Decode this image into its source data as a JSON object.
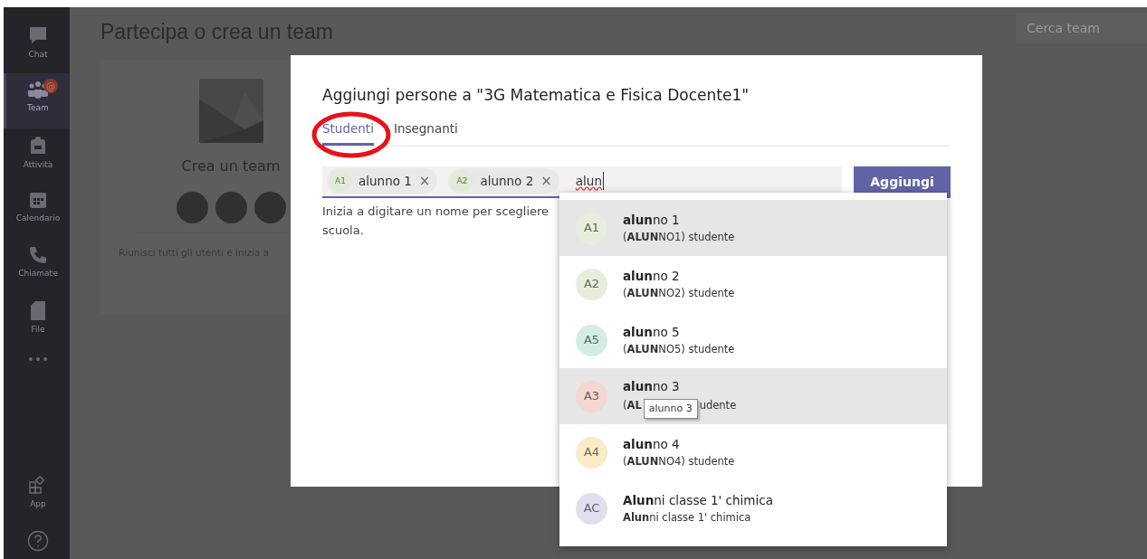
{
  "sidebar": {
    "items": [
      {
        "label": "Chat",
        "selected": false
      },
      {
        "label": "Team",
        "selected": true,
        "badge": "@"
      },
      {
        "label": "Attività",
        "selected": false
      },
      {
        "label": "Calendario",
        "selected": false
      },
      {
        "label": "Chiamate",
        "selected": false
      },
      {
        "label": "File",
        "selected": false
      },
      {
        "selected": false
      }
    ],
    "bottom_items": [
      {
        "label": "App",
        "selected": false
      },
      {
        "selected": false
      }
    ]
  },
  "page": {
    "title": "Partecipa o crea un team",
    "search": {
      "placeholder": "Cerca team"
    },
    "card": {
      "title": "Crea un team",
      "description": "Riunisci tutti gli utenti e inizia a"
    }
  },
  "dialog": {
    "title": "Aggiungi persone a \"3G Matematica e Fisica Docente1\"",
    "tabs": [
      {
        "label": "Studenti",
        "selected": true
      },
      {
        "label": "Insegnanti",
        "selected": false
      }
    ],
    "chips": [
      {
        "initials": "A1",
        "name": "alunno 1",
        "remove": "×"
      },
      {
        "initials": "A2",
        "name": "alunno 2",
        "remove": "×"
      }
    ],
    "typed": "alun",
    "add_button": "Aggiungi",
    "hint_lines": [
      "Inizia a digitare un nome per scegliere",
      "scuola."
    ],
    "suggestions": [
      {
        "initials": "A1",
        "color": "#e7efdc",
        "name": "**alun**no 1",
        "detail": "(**ALUN**NO1) studente",
        "highlighted": true
      },
      {
        "initials": "A2",
        "color": "#e7efdc",
        "name": "**alun**no 2",
        "detail": "(**ALUN**NO2) studente",
        "highlighted": false
      },
      {
        "initials": "A5",
        "color": "#d3ede3",
        "name": "**alun**no 5",
        "detail": "(**ALUN**NO5) studente",
        "highlighted": false
      },
      {
        "initials": "A3",
        "color": "#f4d6d3",
        "name": "**alun**no 3",
        "detail": "(**AL**",
        "detail_tail": "udente",
        "highlighted": true
      },
      {
        "initials": "A4",
        "color": "#f9ecc6",
        "name": "**alun**no 4",
        "detail": "(**ALUN**NO4) studente",
        "highlighted": false
      },
      {
        "initials": "AC",
        "color": "#e2def0",
        "name": "**Alun**ni classe 1' chimica",
        "detail": "**Alun**ni classe 1' chimica",
        "highlighted": false
      }
    ],
    "tooltip": "alunno 3"
  }
}
